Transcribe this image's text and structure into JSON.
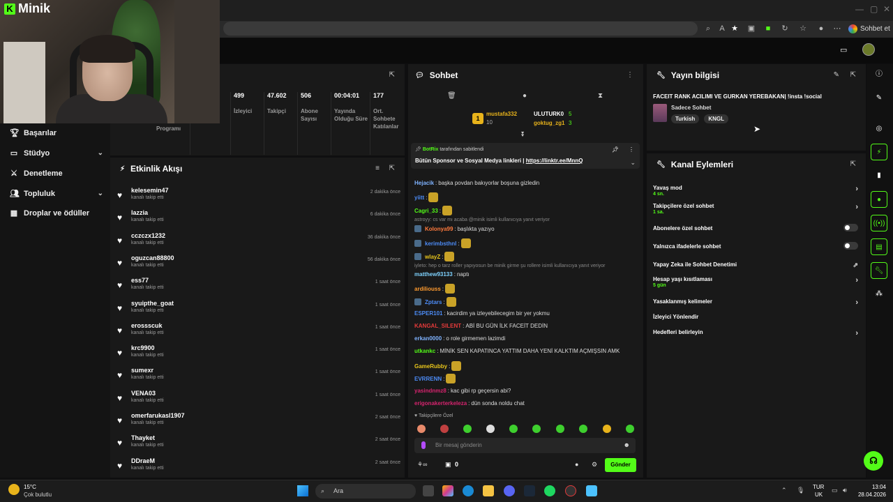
{
  "app": {
    "name": "Minik",
    "accent": "#53fc18"
  },
  "browser": {
    "copilot_label": "Sohbet et"
  },
  "sidebar": {
    "items": [
      {
        "label": "Başarılar",
        "icon": "trophy-icon",
        "chevron": false
      },
      {
        "label": "Stüdyo",
        "icon": "tv-icon",
        "chevron": true
      },
      {
        "label": "Denetleme",
        "icon": "sword-icon",
        "chevron": false
      },
      {
        "label": "Topluluk",
        "icon": "users-icon",
        "chevron": true
      },
      {
        "label": "Droplar ve ödüller",
        "icon": "gift-icon",
        "chevron": false
      }
    ]
  },
  "stats": {
    "partial_label": "Programı",
    "items": [
      {
        "value": "499",
        "label": "İzleyici"
      },
      {
        "value": "47.602",
        "label": "Takipçi"
      },
      {
        "value": "506",
        "label": "Abone Sayısı"
      },
      {
        "value": "00:04:01",
        "label": "Yayında Olduğu Süre"
      },
      {
        "value": "177",
        "label": "Ort. Sohbete Katılanlar"
      }
    ]
  },
  "activity": {
    "title": "Etkinlik Akışı",
    "rows": [
      {
        "name": "kelesemin47",
        "sub": "kanalı takip etti",
        "time": "2 dakika önce"
      },
      {
        "name": "lazzia",
        "sub": "kanalı takip etti",
        "time": "6 dakika önce"
      },
      {
        "name": "cczczx1232",
        "sub": "kanalı takip etti",
        "time": "36 dakika önce"
      },
      {
        "name": "oguzcan88800",
        "sub": "kanalı takip etti",
        "time": "56 dakika önce"
      },
      {
        "name": "ess77",
        "sub": "kanalı takip etti",
        "time": "1 saat önce"
      },
      {
        "name": "syuipthe_goat",
        "sub": "kanalı takip etti",
        "time": "1 saat önce"
      },
      {
        "name": "erossscuk",
        "sub": "kanalı takip etti",
        "time": "1 saat önce"
      },
      {
        "name": "krc9900",
        "sub": "kanalı takip etti",
        "time": "1 saat önce"
      },
      {
        "name": "sumexr",
        "sub": "kanalı takip etti",
        "time": "1 saat önce"
      },
      {
        "name": "VENA03",
        "sub": "kanalı takip etti",
        "time": "1 saat önce"
      },
      {
        "name": "omerfarukasl1907",
        "sub": "kanalı takip etti",
        "time": "2 saat önce"
      },
      {
        "name": "Thayket",
        "sub": "kanalı takip etti",
        "time": "2 saat önce"
      },
      {
        "name": "DDraeM",
        "sub": "kanalı takip etti",
        "time": "2 saat önce"
      }
    ]
  },
  "chat": {
    "title": "Sohbet",
    "top_gifters": [
      {
        "name": "mustafa332",
        "count": "10"
      },
      {
        "name": "ULUTURK0",
        "count": "5"
      },
      {
        "name": "goktug_zg1",
        "count": "3"
      }
    ],
    "rank_number": "1",
    "pinned": {
      "by": "BotRix",
      "by_suffix": "tarafından sabitlendi",
      "text": "Bütün Sponsor ve Sosyal Medya linkleri |",
      "link": "https://linktr.ee/MnnQ"
    },
    "messages": [
      {
        "user": "Hejacik",
        "color": "#7fb3ff",
        "text": "başka povdan bakıyorlar boşuna gizledin",
        "emote": false,
        "reply": ""
      },
      {
        "user": "yiitt",
        "color": "#4c8bf5",
        "text": "",
        "emote": true,
        "reply": ""
      },
      {
        "user": "Cagri_33",
        "color": "#53fc18",
        "text": "",
        "emote": true,
        "reply": ""
      },
      {
        "user": "Kolonya99",
        "color": "#ff7a3d",
        "text": "başlıkta yazıyo",
        "emote": false,
        "reply": "astroyy: cs var mı acaba @minik isimli kullanıcıya yanıt veriyor"
      },
      {
        "user": "kerimbsthnl",
        "color": "#4c8bf5",
        "text": "",
        "emote": true,
        "reply": ""
      },
      {
        "user": "wlayZ",
        "color": "#e8c51b",
        "text": "",
        "emote": true,
        "reply": ""
      },
      {
        "user": "matthew93133",
        "color": "#7fd3ff",
        "text": "naptı",
        "emote": false,
        "reply": "iyleto: hep o tarz roller yapıyosun be minik girme şu rollere isimli kullanıcıya yanıt veriyor"
      },
      {
        "user": "ardiliouss",
        "color": "#ff9b2f",
        "text": "",
        "emote": true,
        "reply": ""
      },
      {
        "user": "Zptars",
        "color": "#4c8bf5",
        "text": "",
        "emote": true,
        "reply": ""
      },
      {
        "user": "ESPER101",
        "color": "#4c8bf5",
        "text": "kacirdim ya izleyebilecegim bir yer yokmu",
        "emote": false,
        "reply": ""
      },
      {
        "user": "KANGAL_SILENT",
        "color": "#e33a3a",
        "text": "ABİ BU GÜN İLK FACEİT DEDİN",
        "emote": false,
        "reply": ""
      },
      {
        "user": "erkan0000",
        "color": "#7fb3ff",
        "text": "o role girmemen lazimdi",
        "emote": false,
        "reply": ""
      },
      {
        "user": "utkankc",
        "color": "#53fc18",
        "text": "MİNİK SEN KAPATINCA YATTIM DAHA YENİ KALKTIM AÇMIŞSIN AMK",
        "emote": false,
        "reply": ""
      },
      {
        "user": "GameRubby",
        "color": "#e8c51b",
        "text": "",
        "emote": true,
        "reply": ""
      },
      {
        "user": "EVRRENN",
        "color": "#4c8bf5",
        "text": "",
        "emote": true,
        "reply": ""
      },
      {
        "user": "yasindnmz8",
        "color": "#d6246e",
        "text": "kac gibi rp geçersin abi?",
        "emote": false,
        "reply": ""
      },
      {
        "user": "erigonakerterkeleza",
        "color": "#d6246e",
        "text": "dün sonda noldu chat",
        "emote": false,
        "reply": ""
      }
    ],
    "followers_only_label": "Takipçilere Özel",
    "input_placeholder": "Bir mesaj gönderin",
    "points": "0",
    "send_label": "Gönder"
  },
  "stream_info": {
    "title": "Yayın bilgisi",
    "stream_title": "FACEIT RANK ACILIMI VE GURKAN YEREBAKAN| !insta !social",
    "category": "Sadece Sohbet",
    "tags": [
      "Turkish",
      "KNGL"
    ]
  },
  "channel_actions": {
    "title": "Kanal Eylemleri",
    "items": [
      {
        "label": "Yavaş mod",
        "sub": "4 sn.",
        "control": "arrow"
      },
      {
        "label": "Takipçilere özel sohbet",
        "sub": "1 sa.",
        "control": "arrow"
      },
      {
        "label": "Abonelere özel sohbet",
        "sub": "",
        "control": "toggle"
      },
      {
        "label": "Yalnızca ifadelerle sohbet",
        "sub": "",
        "control": "toggle"
      },
      {
        "label": "Yapay Zeka ile Sohbet Denetimi",
        "sub": "",
        "control": "external"
      },
      {
        "label": "Hesap yaşı kısıtlaması",
        "sub": "5 gün",
        "control": "arrow"
      },
      {
        "label": "Yasaklanmış kelimeler",
        "sub": "",
        "control": "arrow"
      },
      {
        "label": "İzleyici Yönlendir",
        "sub": "",
        "control": "none"
      },
      {
        "label": "Hedefleri belirleyin",
        "sub": "",
        "control": "arrow"
      }
    ]
  },
  "taskbar": {
    "weather_temp": "15°C",
    "weather_desc": "Çok bulutlu",
    "search_label": "Ara",
    "lang_top": "TUR",
    "lang_bottom": "UK",
    "time": "13:04",
    "date": "28.04.2026"
  }
}
